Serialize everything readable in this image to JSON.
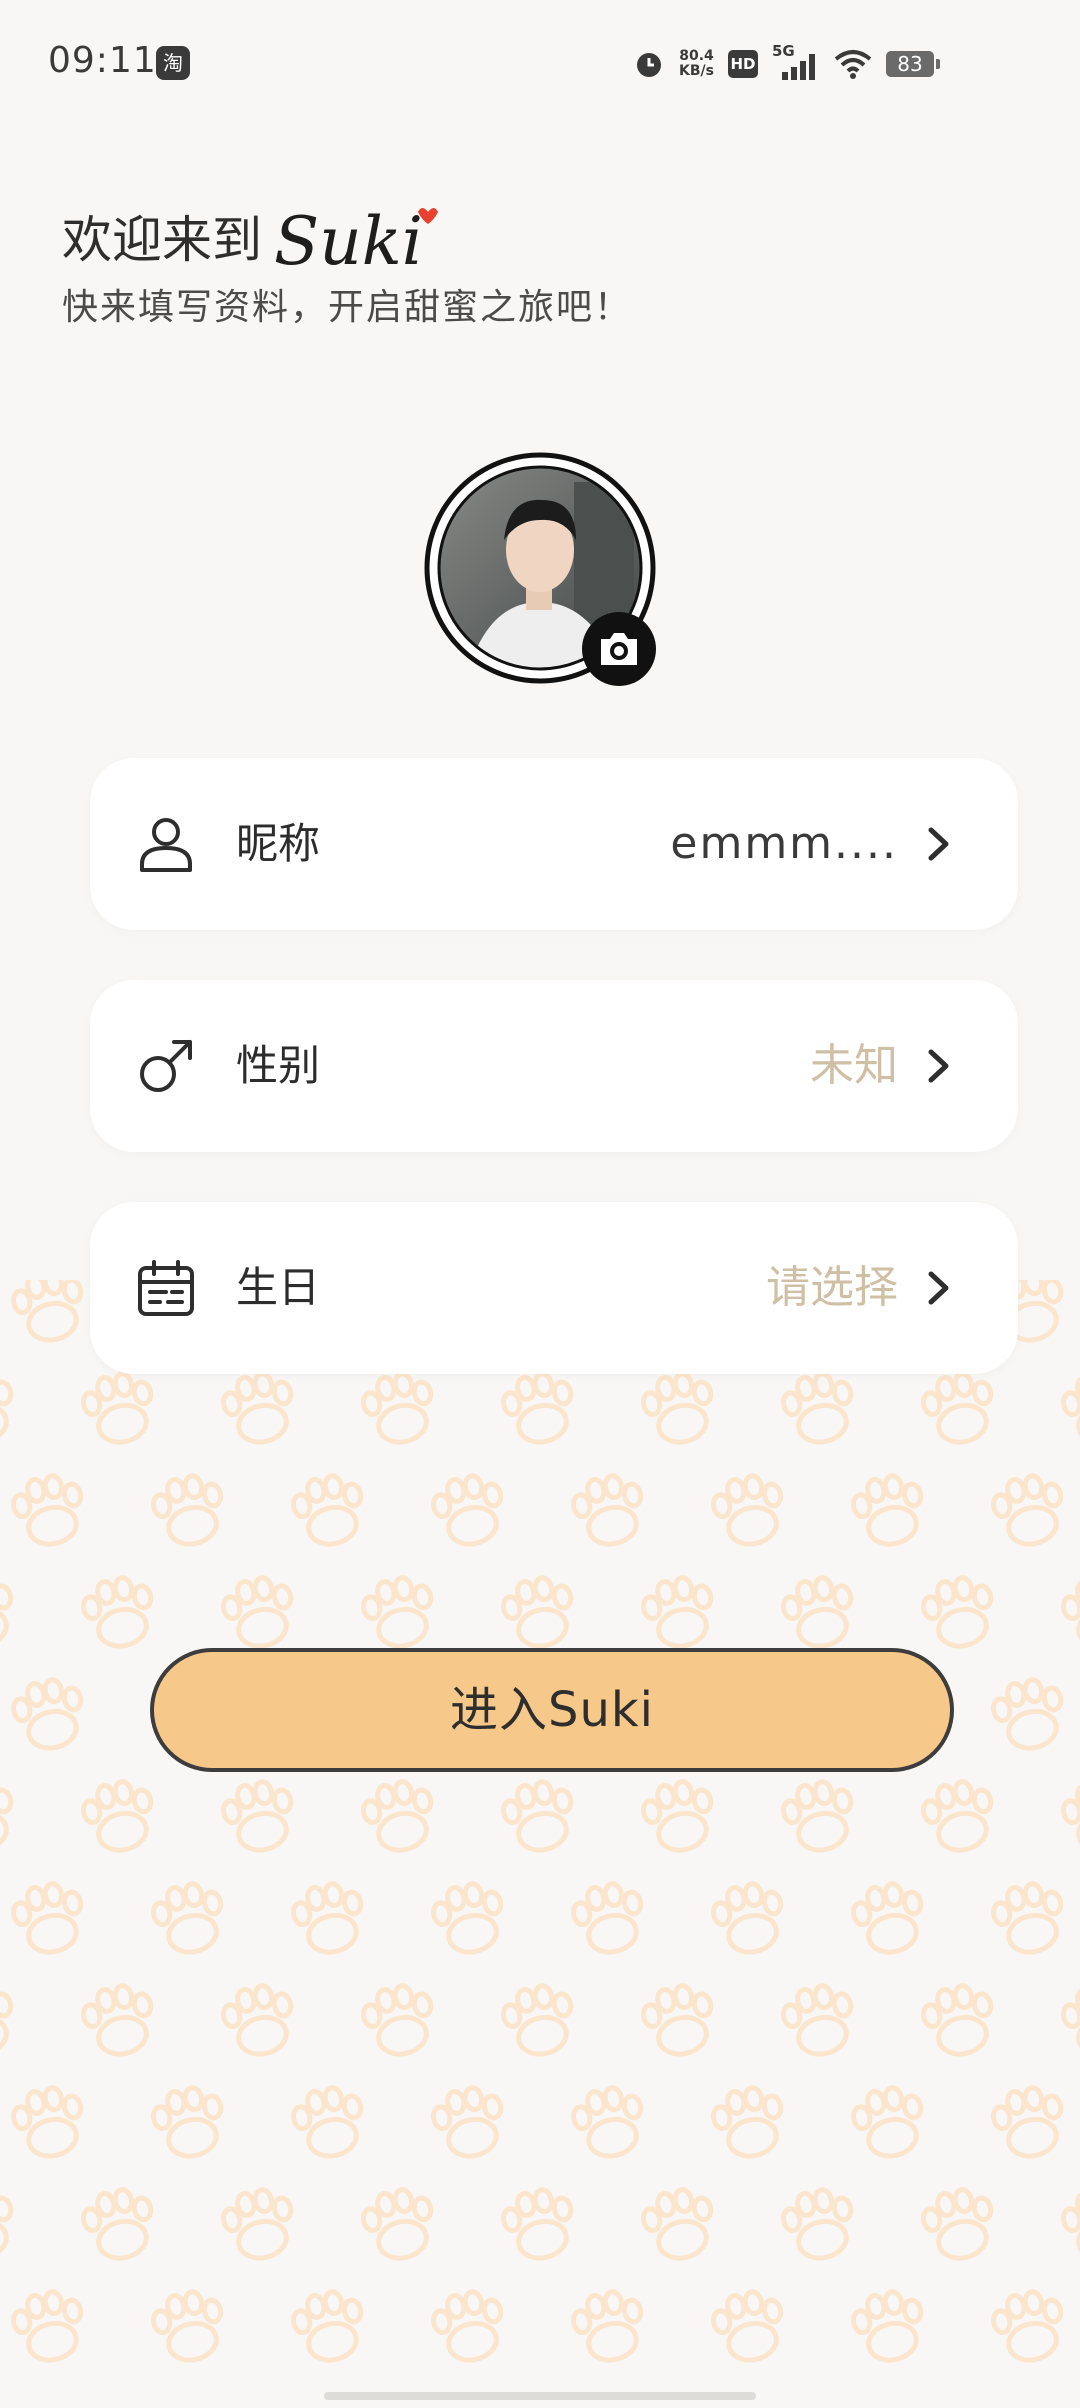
{
  "status_bar": {
    "time": "09:11",
    "app_badge": "淘",
    "net_speed_value": "80.4",
    "net_speed_unit": "KB/s",
    "hd_label": "HD",
    "network_label": "5G",
    "battery": "83",
    "icons": [
      "alarm-icon",
      "hd-icon",
      "signal-icon",
      "wifi-icon",
      "battery-icon"
    ]
  },
  "header": {
    "welcome": "欢迎来到",
    "brand": "Suki",
    "subtitle": "快来填写资料，开启甜蜜之旅吧！"
  },
  "avatar": {
    "icon": "camera-icon"
  },
  "form": {
    "nickname": {
      "label": "昵称",
      "value": "emmm....",
      "icon": "user-icon"
    },
    "gender": {
      "label": "性别",
      "value": "未知",
      "icon": "male-icon"
    },
    "birthday": {
      "label": "生日",
      "value": "请选择",
      "icon": "calendar-icon"
    }
  },
  "cta": {
    "label": "进入Suki"
  },
  "colors": {
    "background": "#f8f7f5",
    "card": "#ffffff",
    "accent": "#f6c98b",
    "placeholder": "#cfbfa5",
    "brand_heart": "#e8412f",
    "paw": "#fbe9d3"
  }
}
